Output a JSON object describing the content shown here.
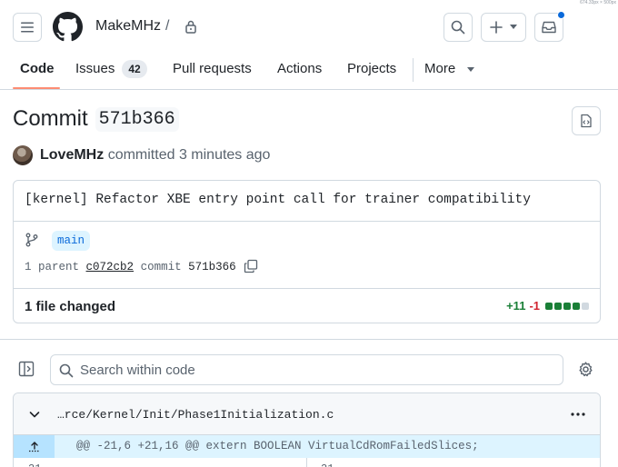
{
  "header": {
    "owner": "MakeMHz",
    "separator": "/",
    "corner_note": "674.33px × 500px"
  },
  "nav": {
    "tabs": [
      {
        "label": "Code",
        "active": true
      },
      {
        "label": "Issues",
        "count": "42"
      },
      {
        "label": "Pull requests"
      },
      {
        "label": "Actions"
      },
      {
        "label": "Projects"
      },
      {
        "label": "More"
      }
    ]
  },
  "commit": {
    "title_prefix": "Commit",
    "sha_short": "571b366",
    "author": "LoveMHz",
    "action": "committed",
    "time": "3 minutes ago",
    "message": "[kernel] Refactor XBE entry point call for trainer compatibility",
    "branch": "main",
    "parent_label": "1 parent",
    "parent_sha": "c072cb2",
    "commit_label": "commit",
    "commit_sha": "571b366"
  },
  "summary": {
    "files_changed": "1 file changed",
    "additions": "+11",
    "deletions": "-1",
    "blocks": [
      "add",
      "add",
      "add",
      "add",
      "neutral"
    ]
  },
  "search": {
    "placeholder": "Search within code"
  },
  "file": {
    "path": "…rce/Kernel/Init/Phase1Initialization.c",
    "hunk_header": "@@ -21,6 +21,16 @@ extern BOOLEAN VirtualCdRomFailedSlices;",
    "line_left": "21",
    "line_right": "21"
  },
  "colors": {
    "accent": "#0969da",
    "nav_underline": "#fd8c73",
    "addition": "#1a7f37",
    "deletion": "#d1242f",
    "neutral_block": "#d1d9e0"
  }
}
